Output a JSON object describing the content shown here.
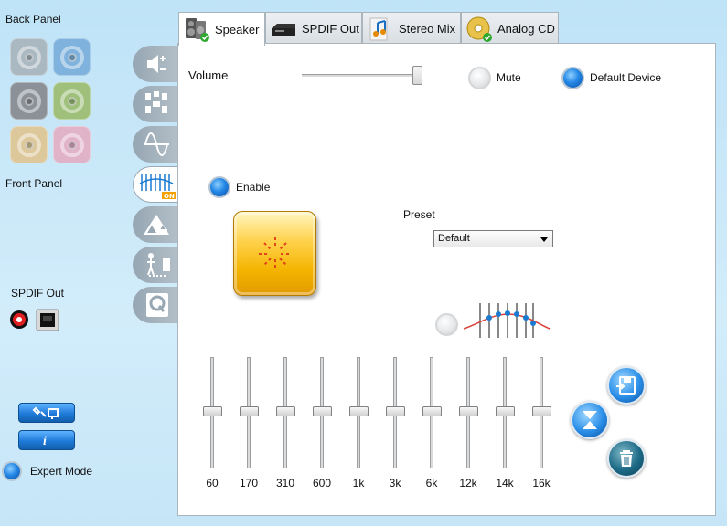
{
  "left_panel": {
    "back_panel_label": "Back Panel",
    "front_panel_label": "Front Panel",
    "spdif_out_label": "SPDIF Out",
    "expert_mode_label": "Expert Mode",
    "back_jacks": [
      {
        "color": "#aab8c2"
      },
      {
        "color": "#7fb3dd"
      },
      {
        "color": "#8b9197"
      },
      {
        "color": "#9ec07a"
      },
      {
        "color": "#dcc89b"
      },
      {
        "color": "#e0b3c8"
      }
    ],
    "side_tabs": [
      "speaker-config-icon",
      "surround-speakers-icon",
      "sine-wave-icon",
      "equalizer-on-icon",
      "environment-icon",
      "room-correction-icon",
      "karaoke-q-icon"
    ],
    "side_tab_on_badge": "ON",
    "bottom_buttons": [
      "tools-icon",
      "info-icon"
    ]
  },
  "tabs": [
    {
      "label": "Speaker",
      "icon": "speaker-icon",
      "active": true
    },
    {
      "label": "SPDIF Out",
      "icon": "spdif-device-icon",
      "active": false
    },
    {
      "label": "Stereo Mix",
      "icon": "music-note-icon",
      "active": false
    },
    {
      "label": "Analog CD",
      "icon": "cd-icon",
      "active": false
    }
  ],
  "speaker": {
    "volume_label": "Volume",
    "volume_level": 0.95,
    "mute_label": "Mute",
    "mute_on": false,
    "default_device_label": "Default Device",
    "default_device_on": true
  },
  "equalizer": {
    "enable_label": "Enable",
    "enabled": true,
    "preset_label": "Preset",
    "preset_value": "Default",
    "bands": [
      "60",
      "170",
      "310",
      "600",
      "1k",
      "3k",
      "6k",
      "12k",
      "14k",
      "16k"
    ],
    "band_levels": [
      0,
      0,
      0,
      0,
      0,
      0,
      0,
      0,
      0,
      0
    ]
  },
  "colors": {
    "accent_blue": "#1f7ad8",
    "enable_button_gold": "#f4b400",
    "panel_background": "#c6e6f8"
  }
}
